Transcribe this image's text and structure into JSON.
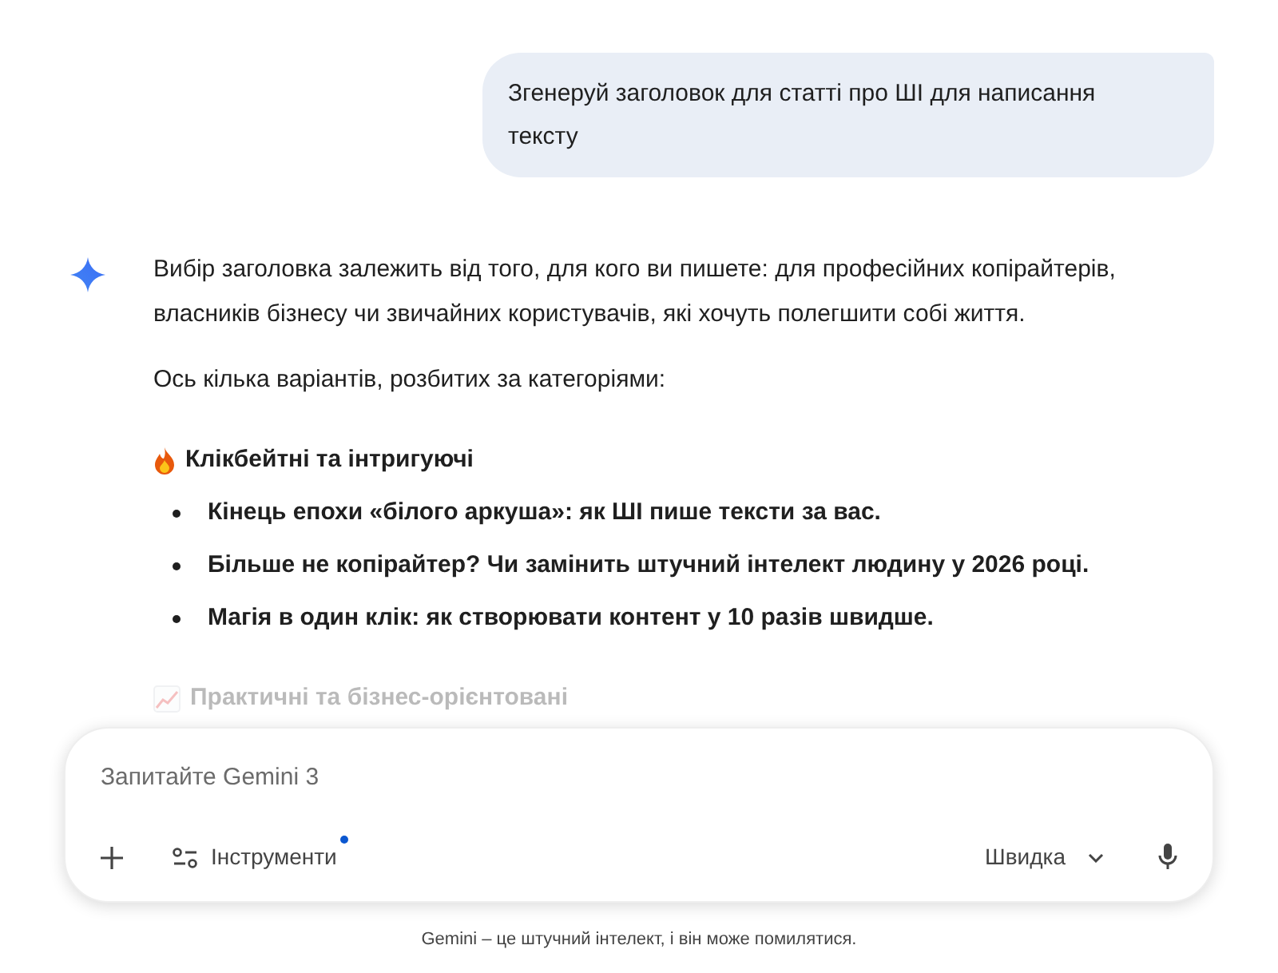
{
  "user_message": "Згенеруй заголовок для статті про ШІ для написання тексту",
  "response": {
    "paragraphs": [
      "Вибір заголовка залежить від того, для кого ви пишете: для професійних копірайтерів, власників бізнесу чи звичайних користувачів, які хочуть полегшити собі життя.",
      "Ось кілька варіантів, розбитих за категоріями:"
    ],
    "sections": [
      {
        "kind": "fire",
        "heading": "Клікбейтні та інтригуючі",
        "faded": false,
        "items": [
          "Кінець епохи «білого аркуша»: як ШІ пише тексти за вас.",
          "Більше не копірайтер? Чи замінить штучний інтелект людину у 2026 році.",
          "Магія в один клік: як створювати контент у 10 разів швидше."
        ]
      },
      {
        "kind": "chart",
        "heading": "Практичні та бізнес-орієнтовані",
        "faded": true
      }
    ]
  },
  "composer": {
    "placeholder": "Запитайте Gemini 3",
    "tools_label": "Інструменти",
    "tools_badge": true,
    "mode": "Швидка"
  },
  "disclaimer": "Gemini – це штучний інтелект, і він може помилятися."
}
